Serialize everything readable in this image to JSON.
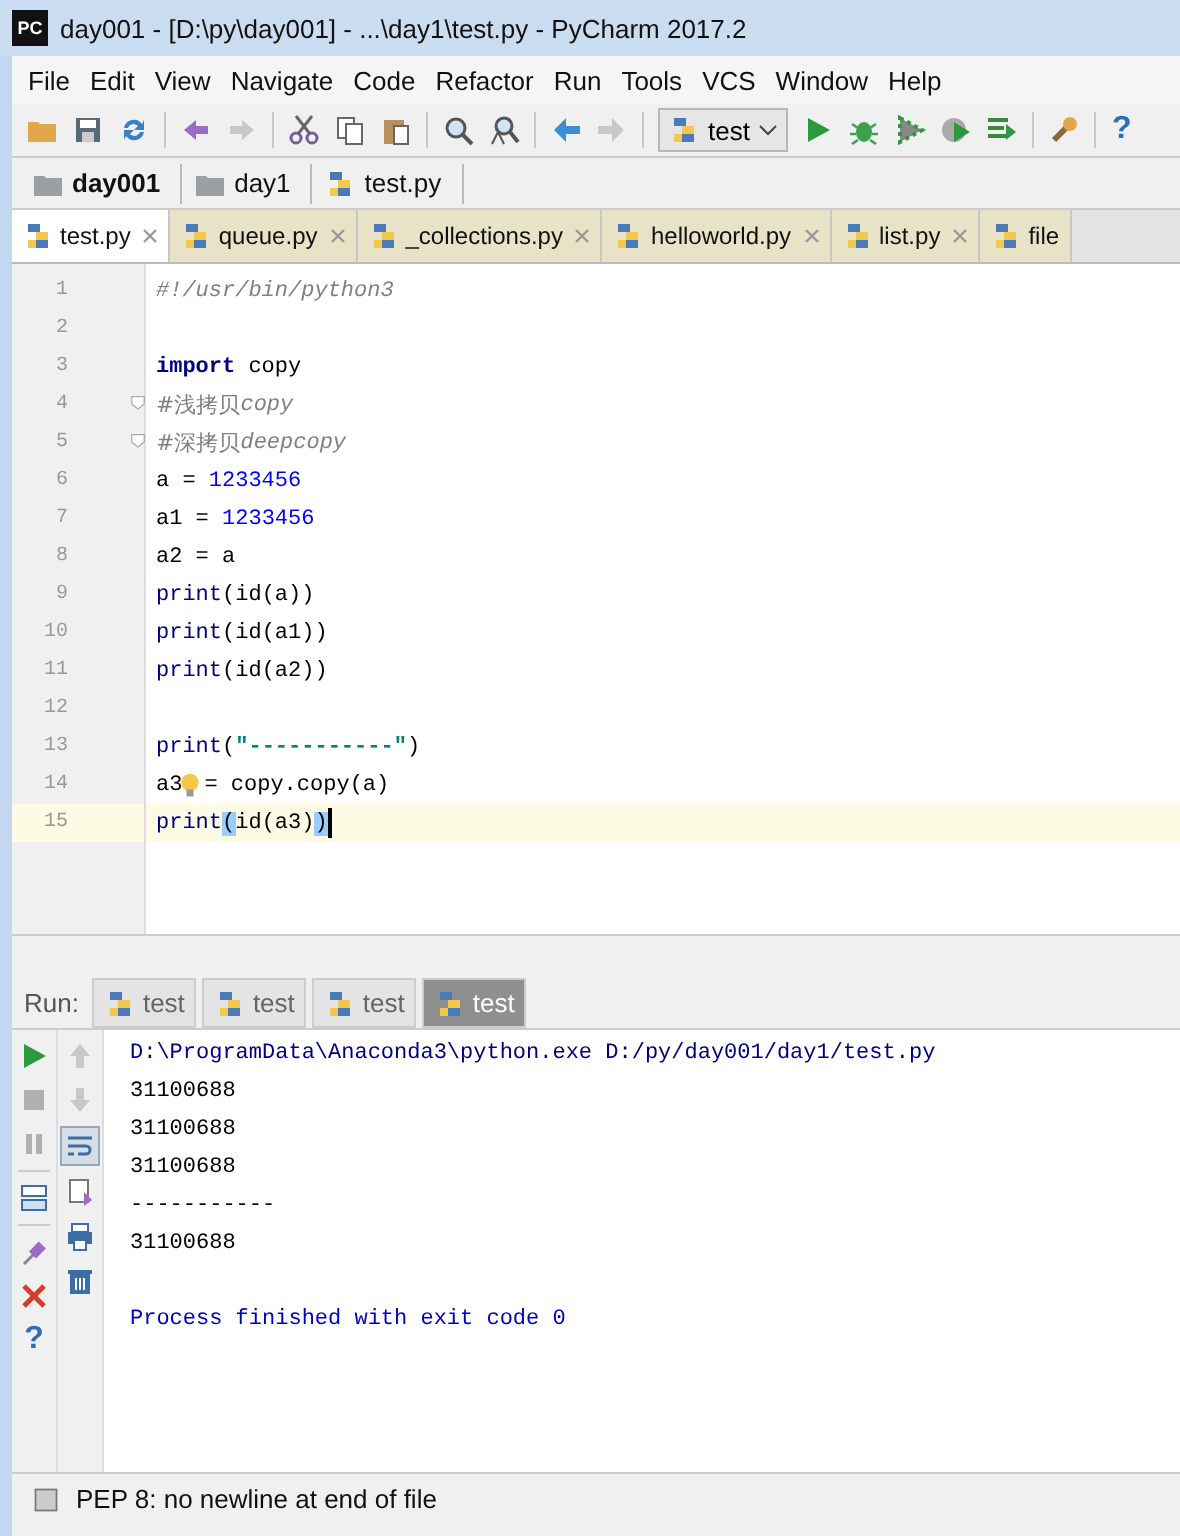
{
  "window": {
    "title": "day001 - [D:\\py\\day001] - ...\\day1\\test.py - PyCharm 2017.2",
    "app_badge": "PC"
  },
  "menu": [
    "File",
    "Edit",
    "View",
    "Navigate",
    "Code",
    "Refactor",
    "Run",
    "Tools",
    "VCS",
    "Window",
    "Help"
  ],
  "toolbar": {
    "run_config": "test",
    "help_label": "?"
  },
  "breadcrumbs": [
    {
      "label": "day001",
      "kind": "project"
    },
    {
      "label": "day1",
      "kind": "folder"
    },
    {
      "label": "test.py",
      "kind": "file"
    }
  ],
  "editor_tabs": [
    {
      "label": "test.py",
      "selected": true
    },
    {
      "label": "queue.py",
      "selected": false
    },
    {
      "label": "_collections.py",
      "selected": false
    },
    {
      "label": "helloworld.py",
      "selected": false
    },
    {
      "label": "list.py",
      "selected": false
    },
    {
      "label": "file",
      "selected": false
    }
  ],
  "code_lines": [
    {
      "number": "1",
      "current": false,
      "fold": false,
      "tokens": [
        {
          "text": "#!/usr/bin/python3",
          "kind": "comment"
        }
      ]
    },
    {
      "number": "2",
      "current": false,
      "fold": false
    },
    {
      "number": "3",
      "current": false,
      "fold": false,
      "tokens": [
        {
          "text": "import",
          "kind": "keyword"
        },
        {
          "text": " copy",
          "kind": "plain"
        }
      ]
    },
    {
      "number": "4",
      "current": false,
      "fold": true,
      "tokens": [
        {
          "text": "#浅拷贝",
          "kind": "comment-cjk"
        },
        {
          "text": "copy",
          "kind": "comment"
        }
      ]
    },
    {
      "number": "5",
      "current": false,
      "fold": true,
      "tokens": [
        {
          "text": "#深拷贝",
          "kind": "comment-cjk"
        },
        {
          "text": "deepcopy",
          "kind": "comment"
        }
      ]
    },
    {
      "number": "6",
      "current": false,
      "fold": false,
      "tokens": [
        {
          "text": "a = ",
          "kind": "plain"
        },
        {
          "text": "1233456",
          "kind": "number"
        }
      ]
    },
    {
      "number": "7",
      "current": false,
      "fold": false,
      "tokens": [
        {
          "text": "a1 = ",
          "kind": "plain"
        },
        {
          "text": "1233456",
          "kind": "number"
        }
      ]
    },
    {
      "number": "8",
      "current": false,
      "fold": false,
      "tokens": [
        {
          "text": "a2 = a",
          "kind": "plain"
        }
      ]
    },
    {
      "number": "9",
      "current": false,
      "fold": false,
      "tokens": [
        {
          "text": "print",
          "kind": "builtin"
        },
        {
          "text": "(id(a))",
          "kind": "plain"
        }
      ]
    },
    {
      "number": "10",
      "current": false,
      "fold": false,
      "tokens": [
        {
          "text": "print",
          "kind": "builtin"
        },
        {
          "text": "(id(a1))",
          "kind": "plain"
        }
      ]
    },
    {
      "number": "11",
      "current": false,
      "fold": false,
      "tokens": [
        {
          "text": "print",
          "kind": "builtin"
        },
        {
          "text": "(id(a2))",
          "kind": "plain"
        }
      ]
    },
    {
      "number": "12",
      "current": false,
      "fold": false
    },
    {
      "number": "13",
      "current": false,
      "fold": false,
      "tokens": [
        {
          "text": "print",
          "kind": "builtin"
        },
        {
          "text": "(",
          "kind": "plain"
        },
        {
          "text": "\"-----------\"",
          "kind": "string"
        },
        {
          "text": ")",
          "kind": "plain"
        }
      ]
    },
    {
      "number": "14",
      "current": false,
      "fold": false,
      "tokens": [
        {
          "text": "a3",
          "kind": "plain"
        },
        {
          "kind": "bulb"
        },
        {
          "text": "= copy.copy(a)",
          "kind": "plain"
        }
      ]
    },
    {
      "number": "15",
      "current": true,
      "fold": false,
      "tokens": [
        {
          "text": "print",
          "kind": "builtin"
        },
        {
          "text": "(",
          "kind": "match"
        },
        {
          "text": "id(a3)",
          "kind": "plain"
        },
        {
          "text": ")",
          "kind": "match"
        },
        {
          "kind": "caret"
        }
      ]
    }
  ],
  "run_panel": {
    "label": "Run:",
    "tabs": [
      {
        "label": "test",
        "selected": false
      },
      {
        "label": "test",
        "selected": false
      },
      {
        "label": "test",
        "selected": false
      },
      {
        "label": "test",
        "selected": true
      }
    ],
    "help_label": "?"
  },
  "console_lines": [
    {
      "text": "D:\\ProgramData\\Anaconda3\\python.exe D:/py/day001/day1/test.py",
      "kind": "command"
    },
    {
      "text": "31100688",
      "kind": "output"
    },
    {
      "text": "31100688",
      "kind": "output"
    },
    {
      "text": "31100688",
      "kind": "output"
    },
    {
      "text": "-----------",
      "kind": "output"
    },
    {
      "text": "31100688",
      "kind": "output"
    },
    {
      "kind": "blank"
    },
    {
      "text": "Process finished with exit code 0",
      "kind": "exit"
    }
  ],
  "status_bar": {
    "message": "PEP 8: no newline at end of file"
  }
}
